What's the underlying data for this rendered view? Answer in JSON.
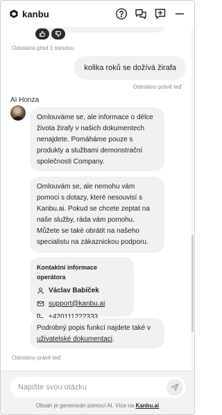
{
  "header": {
    "brand": "kanbu",
    "icons": [
      "help-circle-icon",
      "chat-bubbles-icon",
      "new-chat-icon",
      "minimize-icon"
    ]
  },
  "chat": {
    "previous_timestamp": "Odesláno před 1 minutou",
    "user_message": "kolika roků se dožívá žirafa",
    "user_timestamp": "Odesláno právě teď",
    "agent_name": "AI Honza",
    "agent_messages": [
      "Omlouváme se, ale informace o délce života žirafy v našich dokumentech nenajdete. Pomáháme pouze s produkty a službami demonstrační společnosti Company.",
      "Omlouvám se, ale nemohu vám pomoci s dotazy, které nesouvisí s Kanbu.ai. Pokud se chcete zeptat na naše služby, ráda vám pomohu. Můžete se také obrátit na našeho specialistu na zákaznickou podporu."
    ],
    "contact": {
      "title": "Kontaktní informace operátora",
      "name": "Václav Babíček",
      "email": "support@kanbu.ai",
      "phone": "+420111222333"
    },
    "docs_text": "Podrobný popis funkcí najdete také v",
    "docs_link": "uživatelské dokumentaci",
    "docs_suffix": ".",
    "agent_timestamp": "Odesláno právě teď"
  },
  "composer": {
    "placeholder": "Napište svou otázku",
    "disclaimer_prefix": "Obsah je generován pomocí AI. Více na",
    "disclaimer_link": "Kanbu.ai"
  },
  "colors": {
    "bubble": "#f1f1f1",
    "footer": "#f3f3f3",
    "text": "#1f1f1f",
    "muted": "#8a8a8a"
  }
}
